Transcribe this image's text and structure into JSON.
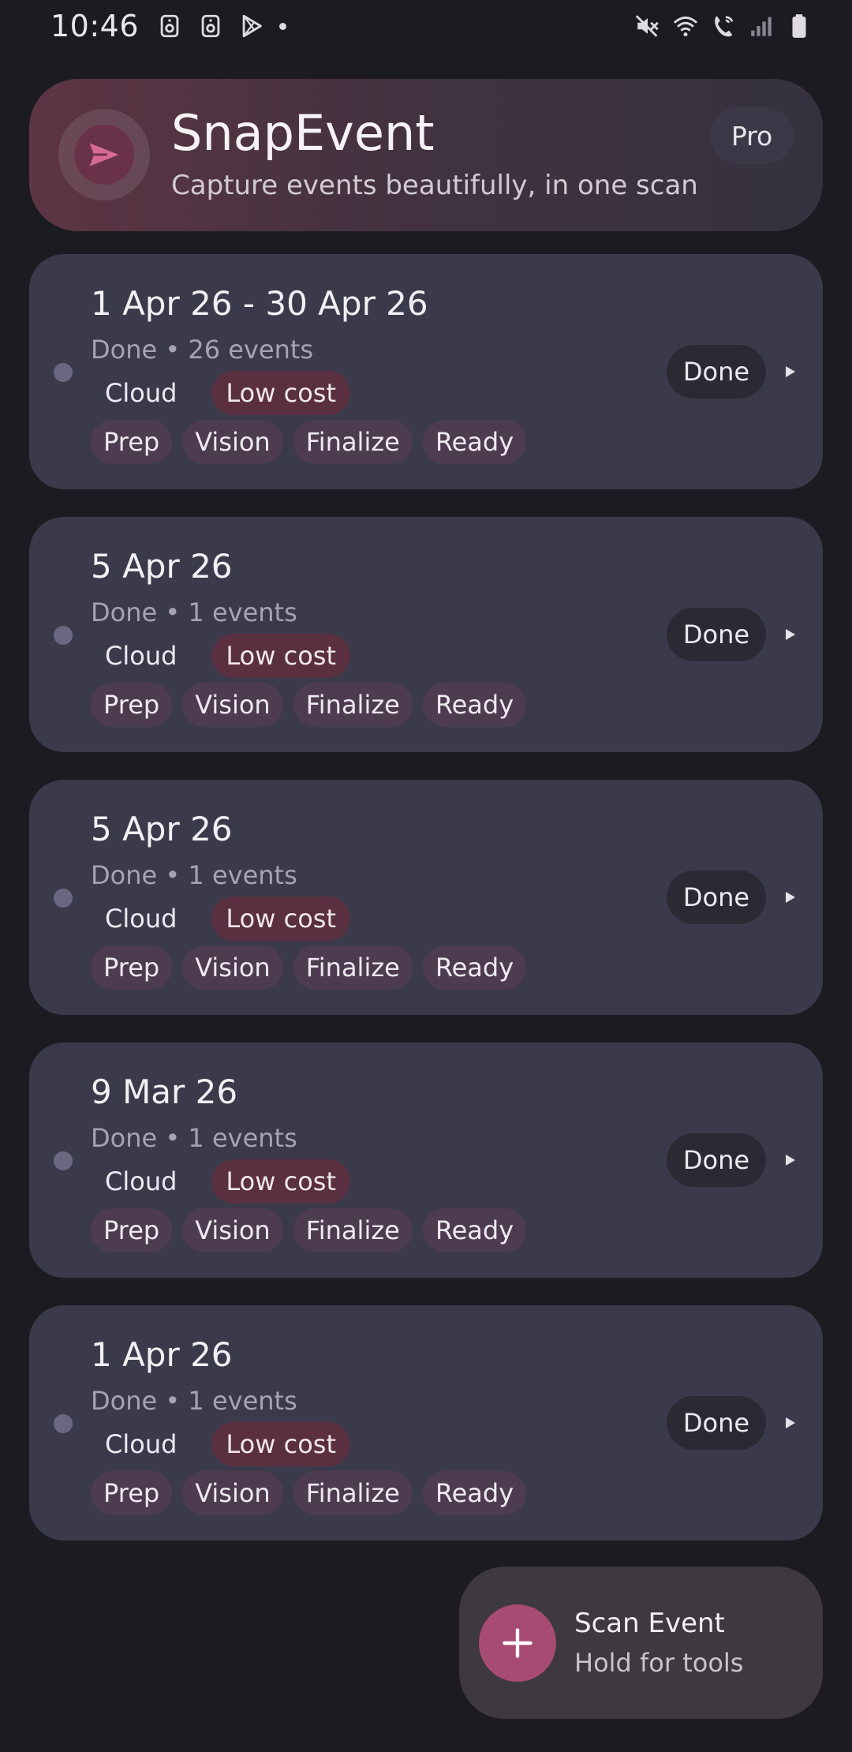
{
  "status_bar": {
    "time": "10:46",
    "left_icons": [
      "storage-icon",
      "speaker-icon",
      "play-store-icon",
      "notification-dot-icon"
    ],
    "right_icons": [
      "mute-icon",
      "wifi-icon",
      "wifi-calling-icon",
      "signal-icon",
      "battery-icon"
    ]
  },
  "header": {
    "title": "SnapEvent",
    "subtitle": "Capture events beautifully, in one scan",
    "badge": "Pro",
    "logo_icon": "paper-plane-icon"
  },
  "batches": [
    {
      "title": "1 Apr 26 - 30 Apr 26",
      "subtitle": "Done • 26 events",
      "mode": "Cloud",
      "cost": "Low cost",
      "steps": [
        "Prep",
        "Vision",
        "Finalize",
        "Ready"
      ],
      "status": "Done"
    },
    {
      "title": "5 Apr 26",
      "subtitle": "Done • 1 events",
      "mode": "Cloud",
      "cost": "Low cost",
      "steps": [
        "Prep",
        "Vision",
        "Finalize",
        "Ready"
      ],
      "status": "Done"
    },
    {
      "title": "5 Apr 26",
      "subtitle": "Done • 1 events",
      "mode": "Cloud",
      "cost": "Low cost",
      "steps": [
        "Prep",
        "Vision",
        "Finalize",
        "Ready"
      ],
      "status": "Done"
    },
    {
      "title": "9 Mar 26",
      "subtitle": "Done • 1 events",
      "mode": "Cloud",
      "cost": "Low cost",
      "steps": [
        "Prep",
        "Vision",
        "Finalize",
        "Ready"
      ],
      "status": "Done"
    },
    {
      "title": "1 Apr 26",
      "subtitle": "Done • 1 events",
      "mode": "Cloud",
      "cost": "Low cost",
      "steps": [
        "Prep",
        "Vision",
        "Finalize",
        "Ready"
      ],
      "status": "Done"
    }
  ],
  "fab": {
    "title": "Scan Event",
    "subtitle": "Hold for tools",
    "icon": "plus-icon"
  },
  "colors": {
    "background": "#1c1b22",
    "card": "#3b3a4a",
    "accent": "#a84b72",
    "low_cost_chip": "#5a2f40",
    "step_chip": "#4d3c4f"
  }
}
